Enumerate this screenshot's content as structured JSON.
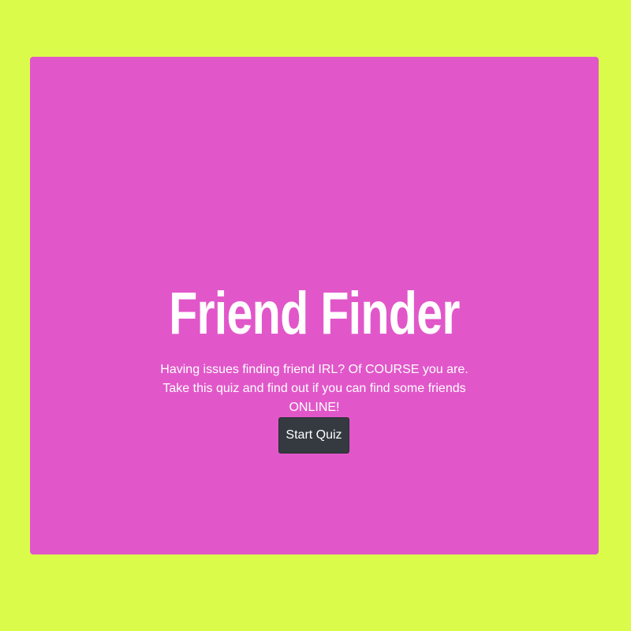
{
  "colors": {
    "page_background": "#dbfb4a",
    "card_background": "#e157c9",
    "button_background": "#343a40",
    "text": "#ffffff"
  },
  "hero": {
    "title": "Friend Finder",
    "description": "Having issues finding friend IRL? Of COURSE you are. Take this quiz and find out if you can find some friends ONLINE!",
    "start_button_label": "Start Quiz"
  }
}
